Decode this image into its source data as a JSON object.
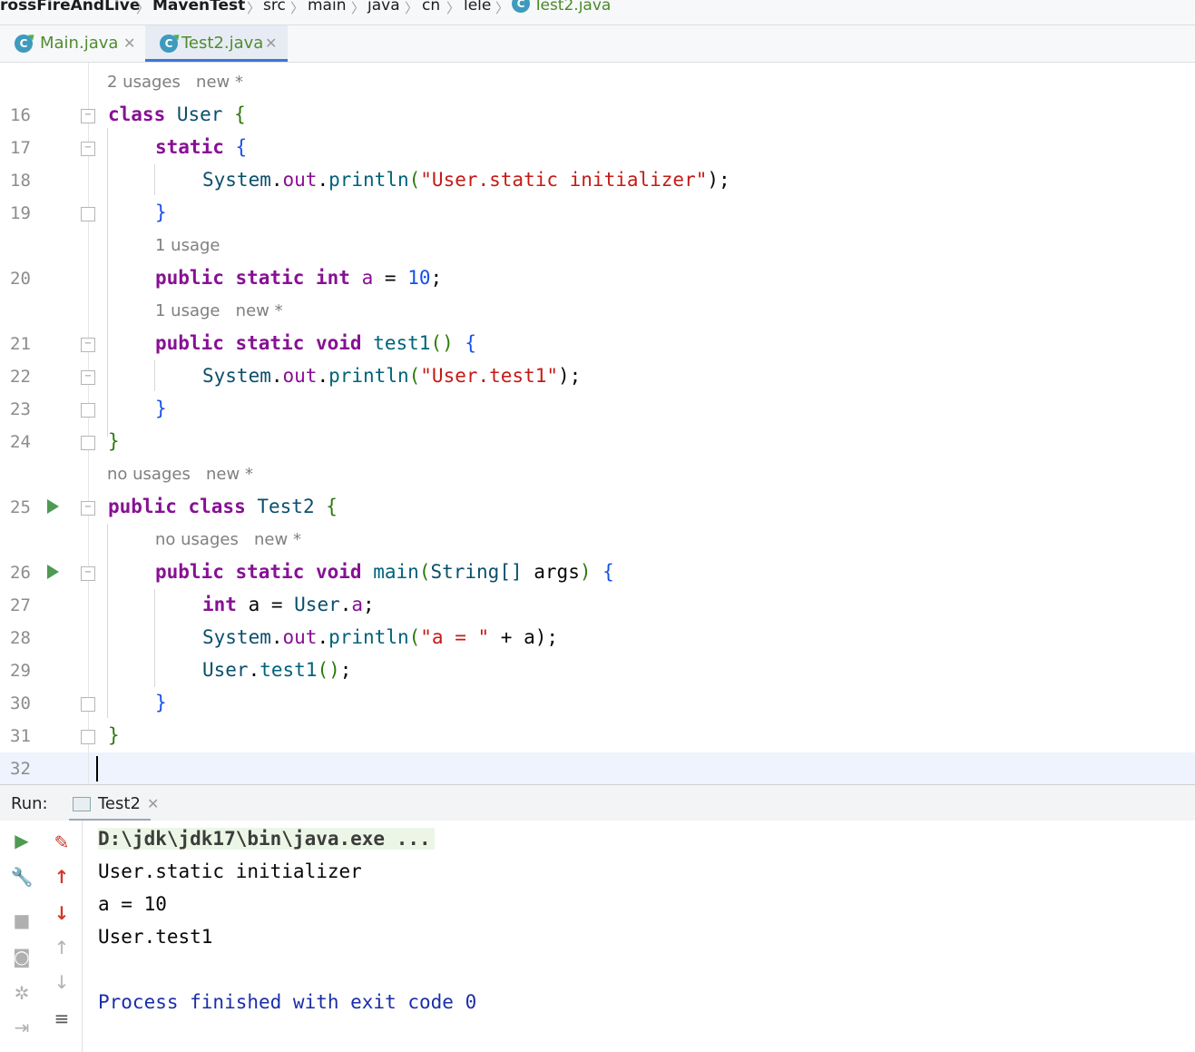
{
  "breadcrumb": {
    "items": [
      "rossFireAndLive",
      "MavenTest",
      "src",
      "main",
      "java",
      "cn",
      "lele",
      "Test2.java"
    ],
    "separator": "〉"
  },
  "tabs": [
    {
      "label": "Main.java",
      "icon": "java-class-icon",
      "active": false
    },
    {
      "label": "Test2.java",
      "icon": "java-class-icon",
      "active": true
    }
  ],
  "editor": {
    "line_numbers": [
      "16",
      "17",
      "18",
      "19",
      "20",
      "21",
      "22",
      "23",
      "24",
      "25",
      "26",
      "27",
      "28",
      "29",
      "30",
      "31",
      "32"
    ],
    "hints": {
      "user_class": {
        "usages": "2 usages",
        "new": "new *"
      },
      "field_a": {
        "usages": "1 usage"
      },
      "test1": {
        "usages": "1 usage",
        "new": "new *"
      },
      "test2_class": {
        "usages": "no usages",
        "new": "new *"
      },
      "main": {
        "usages": "no usages",
        "new": "new *"
      }
    },
    "code": {
      "l16": [
        "class",
        "User",
        "{"
      ],
      "l17": [
        "static",
        "{"
      ],
      "l18": [
        "System",
        ".",
        "out",
        ".",
        "println",
        "(",
        "\"User.static initializer\"",
        ");"
      ],
      "l19": [
        "}"
      ],
      "l20": [
        "public static int",
        "a",
        " = ",
        "10",
        ";"
      ],
      "l21": [
        "public static void",
        "test1",
        "()",
        " {"
      ],
      "l22": [
        "System",
        ".",
        "out",
        ".",
        "println",
        "(",
        "\"User.test1\"",
        ");"
      ],
      "l23": [
        "}"
      ],
      "l24": [
        "}"
      ],
      "l25": [
        "public class",
        "Test2",
        "{"
      ],
      "l26": [
        "public static void",
        "main",
        "(",
        "String[]",
        " args",
        ")",
        " {"
      ],
      "l27": [
        "int",
        " a = ",
        "User",
        ".",
        "a",
        ";"
      ],
      "l28": [
        "System",
        ".",
        "out",
        ".",
        "println",
        "(",
        "\"a = \"",
        " + a",
        ");"
      ],
      "l29": [
        "User",
        ".",
        "test1",
        "()",
        ";"
      ],
      "l30": [
        "}"
      ],
      "l31": [
        "}"
      ]
    }
  },
  "run_panel": {
    "label": "Run:",
    "tab_label": "Test2",
    "output": [
      "D:\\jdk\\jdk17\\bin\\java.exe ...",
      "User.static initializer",
      "a = 10",
      "User.test1",
      "",
      "Process finished with exit code 0"
    ]
  },
  "colors": {
    "keyword": "#871094",
    "string": "#c41a16",
    "number": "#1750eb",
    "run_green": "#4e9a53",
    "active_tab_underline": "#3d76d6"
  }
}
